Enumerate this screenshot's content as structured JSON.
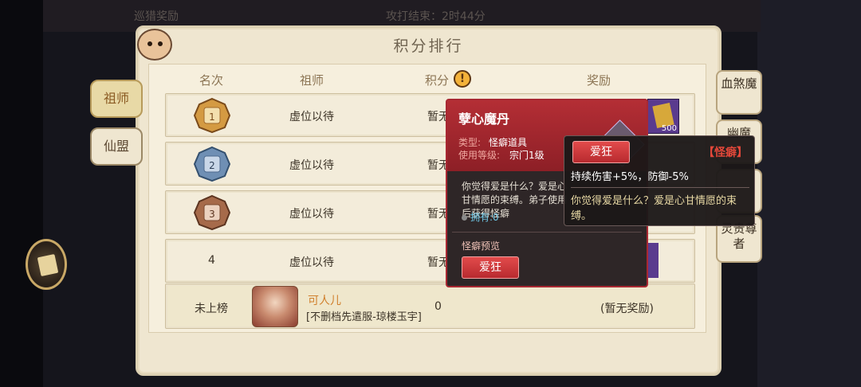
{
  "top_faint": {
    "left": "巡猎奖励",
    "mid": "攻打结束：2时44分"
  },
  "panel": {
    "title": "积分排行",
    "headers": {
      "rank": "名次",
      "master": "祖师",
      "score": "积分",
      "reward": "奖励"
    }
  },
  "left_tabs": [
    "祖师",
    "仙盟"
  ],
  "right_tabs": [
    "血煞魔",
    "幽魔",
    "",
    "灵贵尊者"
  ],
  "rows": [
    {
      "rank": "1",
      "name": "虚位以待",
      "score": "暂无"
    },
    {
      "rank": "2",
      "name": "虚位以待",
      "score": "暂无"
    },
    {
      "rank": "3",
      "name": "虚位以待",
      "score": "暂无"
    },
    {
      "rank": "4",
      "name": "虚位以待",
      "score": "暂无"
    }
  ],
  "self_row": {
    "rank": "未上榜",
    "nickname": "可人儿",
    "server": "[不删档先遣服-琼楼玉宇]",
    "score": "0",
    "reward": "(暂无奖励)"
  },
  "reward_strip": {
    "count": "500"
  },
  "item_popup": {
    "name": "孽心魔丹",
    "type_label": "类型:",
    "type_value": "怪癖道具",
    "level_label": "使用等级:",
    "level_value": "宗门1级",
    "description": "你觉得爱是什么？爱是心甘情愿的束缚。弟子使用后获得怪癖",
    "own_label": "拥有:",
    "own_value": "0",
    "preview_label": "怪癖预览",
    "preview_button": "爱狂"
  },
  "trait_popup": {
    "button": "爱狂",
    "tag": "【怪癖】",
    "effect": "持续伤害+5%，防御-5%",
    "description": "你觉得爱是什么？爱是心甘情愿的束缚。"
  },
  "colors": {
    "panel_bg": "#efe6d0",
    "popup_red": "#b42e35",
    "trait_tag": "#e5483a",
    "own_value": "#6fc7e6",
    "nickname": "#d07f2c"
  }
}
